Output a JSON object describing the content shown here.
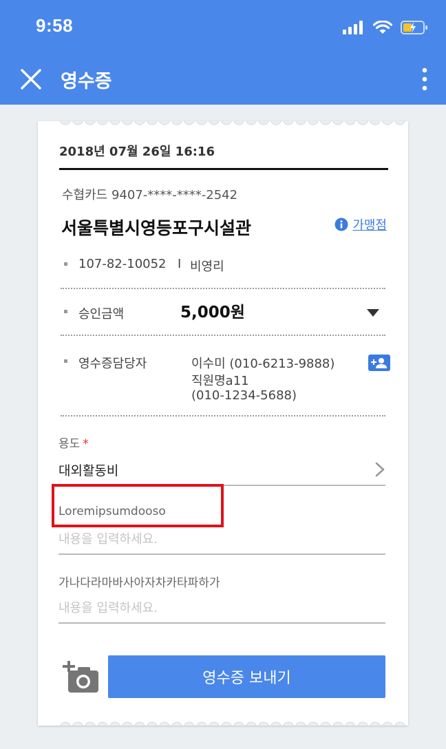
{
  "status_bar": {
    "time": "9:58"
  },
  "app_bar": {
    "title": "영수증"
  },
  "receipt": {
    "datetime": "2018년 07월 26일 16:16",
    "card_info": "수협카드 9407-****-****-2542",
    "merchant_name": "서울특별시영등포구시설관",
    "merchant_link": "가맹점",
    "business_number": "107-82-10052",
    "separator": "I",
    "business_type": "비영리",
    "approval_label": "승인금액",
    "approval_amount": "5,000원",
    "manager_label": "영수증담당자",
    "manager_lines": [
      "이수미 (010-6213-9888)",
      "직원명a11",
      "(010-1234-5688)"
    ]
  },
  "form": {
    "purpose_label": "용도",
    "required_mark": "*",
    "purpose_value": "대외활동비",
    "field2_label": "Loremipsumdooso",
    "field2_placeholder": "내용을 입력하세요.",
    "field3_label": "가나다라마바사아자차카타파하가",
    "field3_placeholder": "내용을 입력하세요."
  },
  "actions": {
    "send_label": "영수증 보내기"
  },
  "icons": [
    "close-icon",
    "more-vert-icon",
    "info-icon",
    "add-contact-icon",
    "chevron-right-icon",
    "add-photo-icon",
    "signal-icon",
    "wifi-icon",
    "battery-icon"
  ],
  "colors": {
    "primary": "#4a87ea",
    "highlight_box": "#e0121a",
    "required": "#e0332b",
    "link": "#3b7be0"
  }
}
